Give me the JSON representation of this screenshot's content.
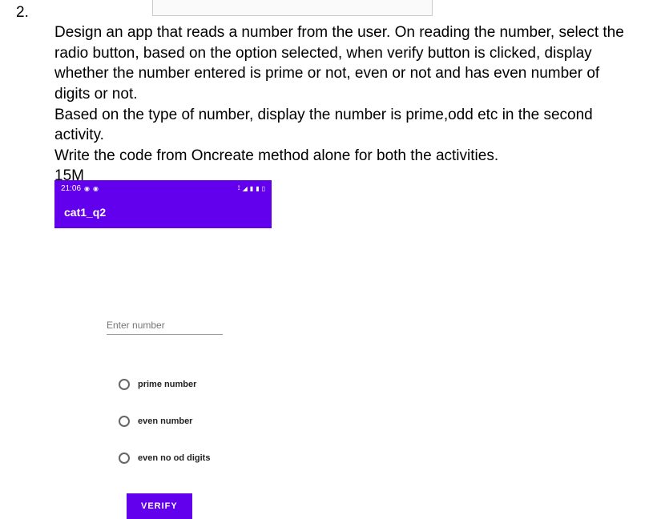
{
  "question": {
    "number": "2.",
    "line1": "Design an app that reads a number from the user. On reading the number, select the",
    "line2": "radio button, based on the option selected, when verify button is clicked, display",
    "line3": "whether the number entered is prime or not, even or not and has even number of",
    "line4": "digits or not.",
    "line5": "Based on the type of number, display the number is prime,odd etc in the second",
    "line6": "activity.",
    "line7": "Write the code from Oncreate method alone for both the activities.",
    "marks": "15M"
  },
  "phone": {
    "status_time": "21:06",
    "app_title": "cat1_q2",
    "input_placeholder": "Enter number",
    "radio1": "prime number",
    "radio2": "even number",
    "radio3": "even no od digits",
    "verify_label": "VERIFY"
  }
}
